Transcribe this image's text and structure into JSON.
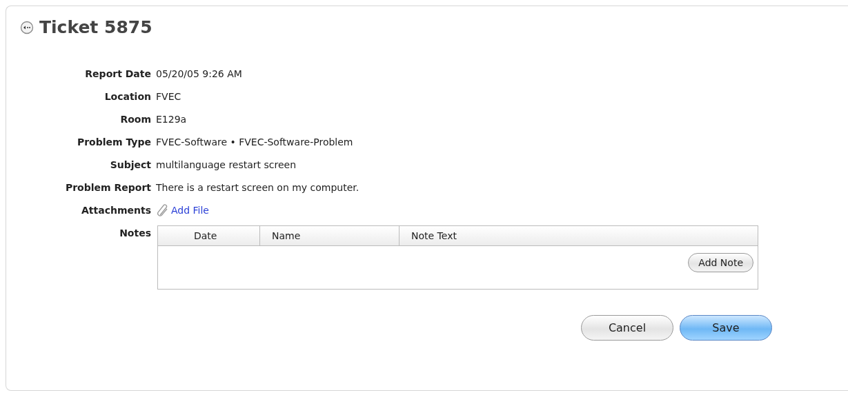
{
  "title": "Ticket 5875",
  "fields": [
    {
      "label": "Report Date",
      "value": "05/20/05 9:26 AM"
    },
    {
      "label": "Location",
      "value": "FVEC"
    },
    {
      "label": "Room",
      "value": "E129a"
    },
    {
      "label": "Problem Type",
      "value": "FVEC-Software • FVEC-Software-Problem"
    },
    {
      "label": "Subject",
      "value": "multilanguage restart screen"
    },
    {
      "label": "Problem Report",
      "value": "There is a restart screen on my computer."
    }
  ],
  "attachments": {
    "label": "Attachments",
    "link": "Add File"
  },
  "notes": {
    "label": "Notes",
    "columns": [
      "Date",
      "Name",
      "Note Text"
    ],
    "button": "Add Note"
  },
  "buttons": [
    {
      "label": "Cancel",
      "kind": "default"
    },
    {
      "label": "Save",
      "kind": "primary"
    }
  ]
}
